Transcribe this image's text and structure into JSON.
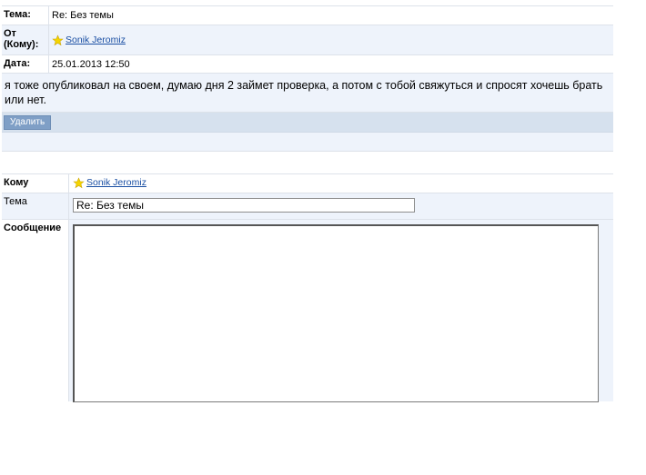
{
  "message": {
    "subject_label": "Тема:",
    "subject_value": "Re: Без темы",
    "from_label": "От (Кому):",
    "from_user": "Sonik Jeromiz",
    "date_label": "Дата:",
    "date_value": "25.01.2013 12:50",
    "body": "я тоже опубликовал на своем, думаю дня 2 займет проверка, а потом с тобой свяжуться и спросят хочешь брать или нет.",
    "delete_label": "Удалить"
  },
  "reply": {
    "to_label": "Кому",
    "to_user": "Sonik Jeromiz",
    "subject_label": "Тема",
    "subject_value": "Re: Без темы",
    "message_label": "Сообщение",
    "message_value": ""
  },
  "icons": {
    "user": "star-icon"
  },
  "colors": {
    "star": "#f4d400",
    "link": "#1a4fa3",
    "button": "#7f9fc6",
    "row_alt": "#eef3fb"
  }
}
